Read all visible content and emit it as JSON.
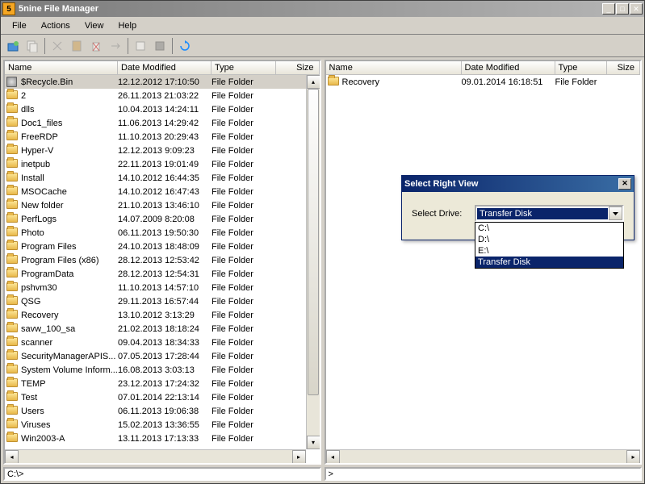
{
  "window_title": "5nine File Manager",
  "titlebar_icon_text": "5",
  "menubar": [
    "File",
    "Actions",
    "View",
    "Help"
  ],
  "columns": {
    "name": "Name",
    "date": "Date Modified",
    "type": "Type",
    "size": "Size"
  },
  "left_pane": {
    "path": "C:\\>",
    "rows": [
      {
        "name": "$Recycle.Bin",
        "date": "12.12.2012 17:10:50",
        "type": "File Folder",
        "icon": "recycle",
        "selected": true
      },
      {
        "name": "2",
        "date": "26.11.2013 21:03:22",
        "type": "File Folder",
        "icon": "folder"
      },
      {
        "name": "dlls",
        "date": "10.04.2013 14:24:11",
        "type": "File Folder",
        "icon": "folder"
      },
      {
        "name": "Doc1_files",
        "date": "11.06.2013 14:29:42",
        "type": "File Folder",
        "icon": "folder"
      },
      {
        "name": "FreeRDP",
        "date": "11.10.2013 20:29:43",
        "type": "File Folder",
        "icon": "folder"
      },
      {
        "name": "Hyper-V",
        "date": "12.12.2013 9:09:23",
        "type": "File Folder",
        "icon": "folder"
      },
      {
        "name": "inetpub",
        "date": "22.11.2013 19:01:49",
        "type": "File Folder",
        "icon": "folder"
      },
      {
        "name": "Install",
        "date": "14.10.2012 16:44:35",
        "type": "File Folder",
        "icon": "folder"
      },
      {
        "name": "MSOCache",
        "date": "14.10.2012 16:47:43",
        "type": "File Folder",
        "icon": "folder"
      },
      {
        "name": "New folder",
        "date": "21.10.2013 13:46:10",
        "type": "File Folder",
        "icon": "folder"
      },
      {
        "name": "PerfLogs",
        "date": "14.07.2009 8:20:08",
        "type": "File Folder",
        "icon": "folder"
      },
      {
        "name": "Photo",
        "date": "06.11.2013 19:50:30",
        "type": "File Folder",
        "icon": "folder"
      },
      {
        "name": "Program Files",
        "date": "24.10.2013 18:48:09",
        "type": "File Folder",
        "icon": "folder"
      },
      {
        "name": "Program Files (x86)",
        "date": "28.12.2013 12:53:42",
        "type": "File Folder",
        "icon": "folder"
      },
      {
        "name": "ProgramData",
        "date": "28.12.2013 12:54:31",
        "type": "File Folder",
        "icon": "folder"
      },
      {
        "name": "pshvm30",
        "date": "11.10.2013 14:57:10",
        "type": "File Folder",
        "icon": "folder"
      },
      {
        "name": "QSG",
        "date": "29.11.2013 16:57:44",
        "type": "File Folder",
        "icon": "folder"
      },
      {
        "name": "Recovery",
        "date": "13.10.2012 3:13:29",
        "type": "File Folder",
        "icon": "folder"
      },
      {
        "name": "savw_100_sa",
        "date": "21.02.2013 18:18:24",
        "type": "File Folder",
        "icon": "folder"
      },
      {
        "name": "scanner",
        "date": "09.04.2013 18:34:33",
        "type": "File Folder",
        "icon": "folder"
      },
      {
        "name": "SecurityManagerAPIS...",
        "date": "07.05.2013 17:28:44",
        "type": "File Folder",
        "icon": "folder"
      },
      {
        "name": "System Volume Inform...",
        "date": "16.08.2013 3:03:13",
        "type": "File Folder",
        "icon": "folder"
      },
      {
        "name": "TEMP",
        "date": "23.12.2013 17:24:32",
        "type": "File Folder",
        "icon": "folder"
      },
      {
        "name": "Test",
        "date": "07.01.2014 22:13:14",
        "type": "File Folder",
        "icon": "folder"
      },
      {
        "name": "Users",
        "date": "06.11.2013 19:06:38",
        "type": "File Folder",
        "icon": "folder"
      },
      {
        "name": "Viruses",
        "date": "15.02.2013 13:36:55",
        "type": "File Folder",
        "icon": "folder"
      },
      {
        "name": "Win2003-A",
        "date": "13.11.2013 17:13:33",
        "type": "File Folder",
        "icon": "folder"
      }
    ]
  },
  "right_pane": {
    "path": ">",
    "rows": [
      {
        "name": "Recovery",
        "date": "09.01.2014 16:18:51",
        "type": "File Folder",
        "icon": "folder"
      }
    ]
  },
  "dialog": {
    "title": "Select Right View",
    "label": "Select Drive:",
    "selected": "Transfer Disk",
    "options": [
      "C:\\",
      "D:\\",
      "E:\\",
      "Transfer Disk"
    ],
    "selected_index": 3
  }
}
